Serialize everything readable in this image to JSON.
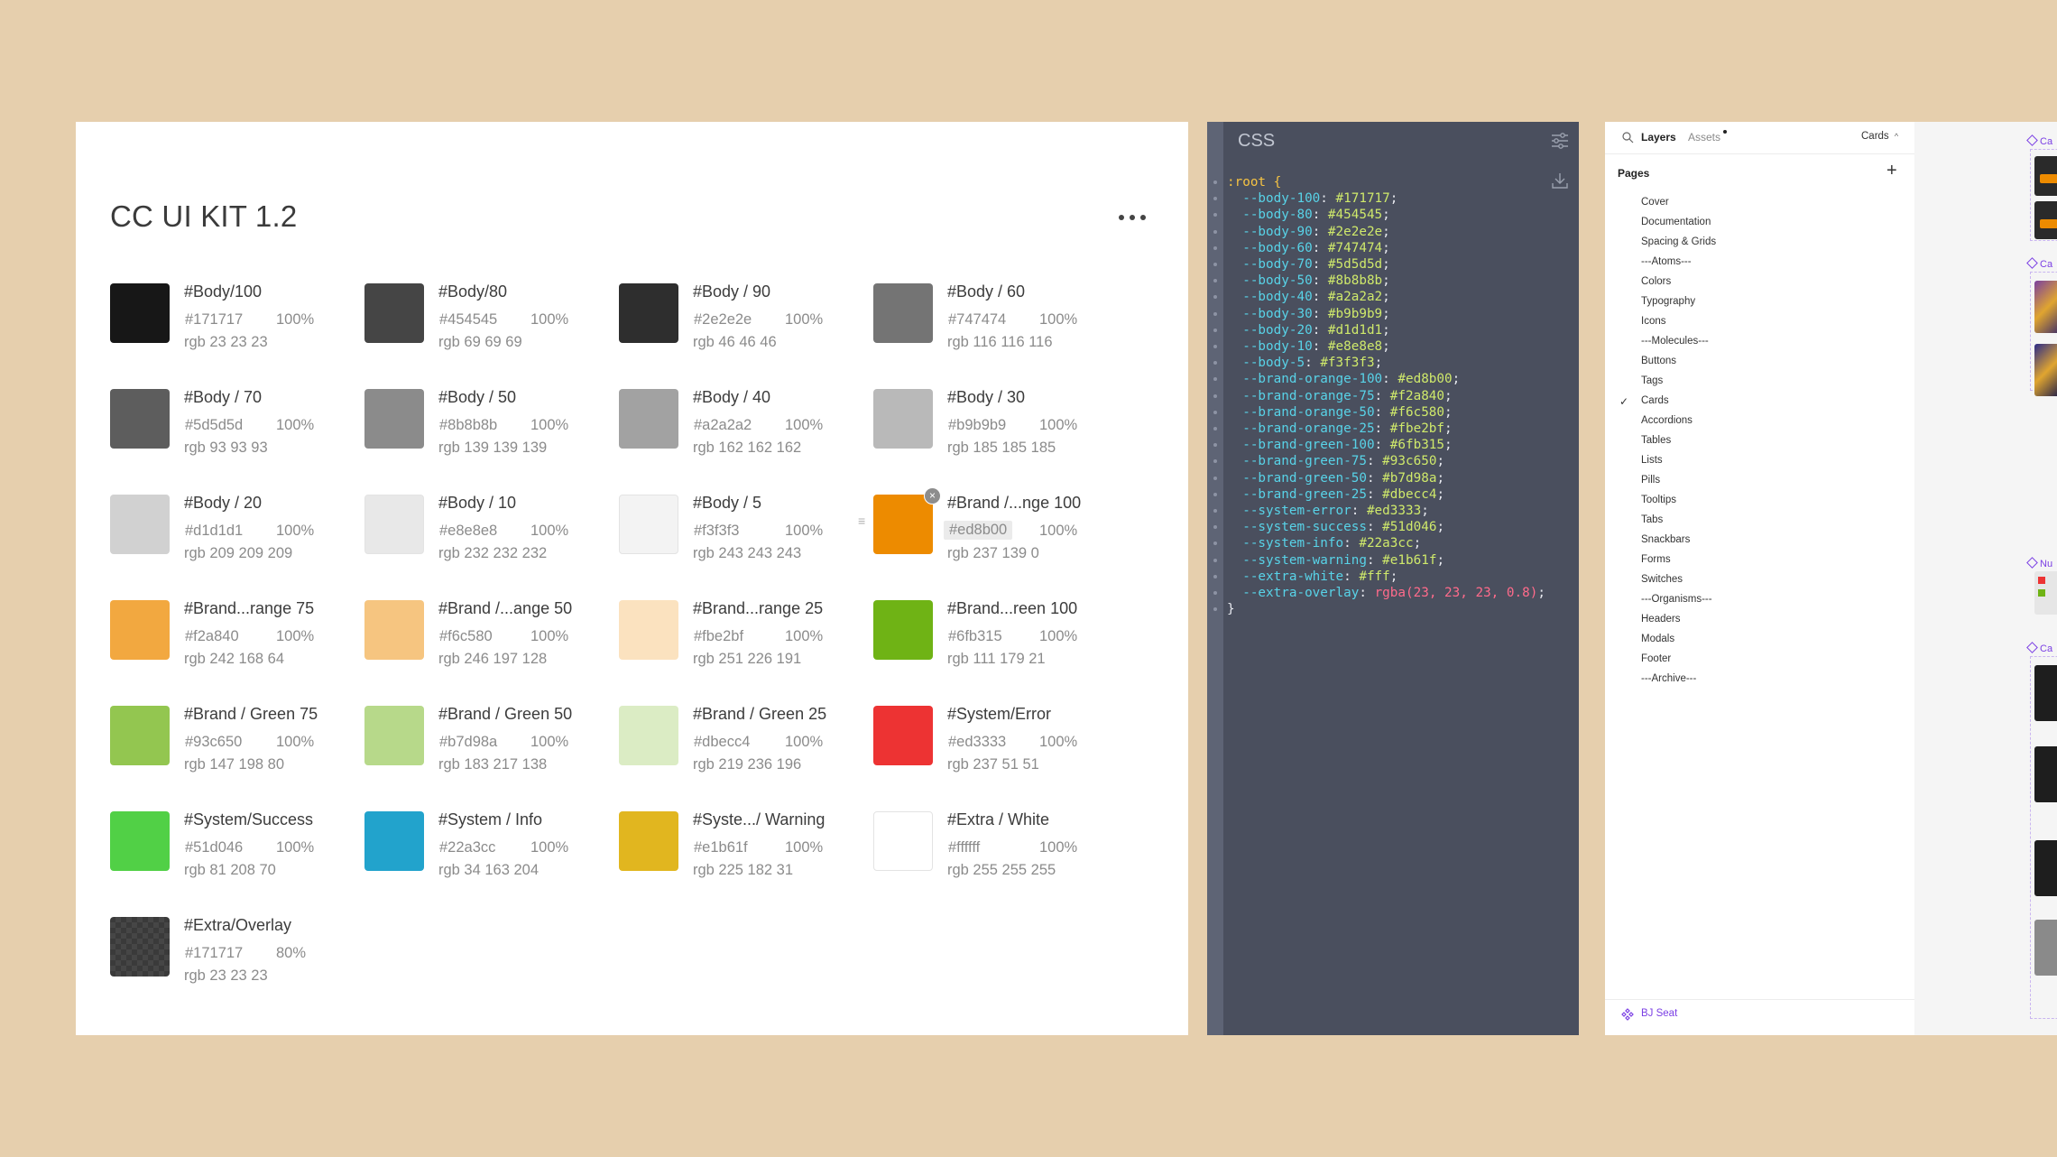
{
  "palette": {
    "title": "CC UI KIT 1.2",
    "swatches": [
      {
        "name": "#Body/100",
        "hex": "#171717",
        "opacity": "100%",
        "rgb": "rgb 23 23 23",
        "color": "#171717"
      },
      {
        "name": "#Body/80",
        "hex": "#454545",
        "opacity": "100%",
        "rgb": "rgb 69 69 69",
        "color": "#454545"
      },
      {
        "name": "#Body / 90",
        "hex": "#2e2e2e",
        "opacity": "100%",
        "rgb": "rgb 46 46 46",
        "color": "#2e2e2e"
      },
      {
        "name": "#Body / 60",
        "hex": "#747474",
        "opacity": "100%",
        "rgb": "rgb 116 116 116",
        "color": "#747474"
      },
      {
        "name": "#Body / 70",
        "hex": "#5d5d5d",
        "opacity": "100%",
        "rgb": "rgb 93 93 93",
        "color": "#5d5d5d"
      },
      {
        "name": "#Body / 50",
        "hex": "#8b8b8b",
        "opacity": "100%",
        "rgb": "rgb 139 139 139",
        "color": "#8b8b8b"
      },
      {
        "name": "#Body / 40",
        "hex": "#a2a2a2",
        "opacity": "100%",
        "rgb": "rgb 162 162 162",
        "color": "#a2a2a2"
      },
      {
        "name": "#Body / 30",
        "hex": "#b9b9b9",
        "opacity": "100%",
        "rgb": "rgb 185 185 185",
        "color": "#b9b9b9"
      },
      {
        "name": "#Body / 20",
        "hex": "#d1d1d1",
        "opacity": "100%",
        "rgb": "rgb 209 209 209",
        "color": "#d1d1d1"
      },
      {
        "name": "#Body / 10",
        "hex": "#e8e8e8",
        "opacity": "100%",
        "rgb": "rgb 232 232 232",
        "color": "#e8e8e8"
      },
      {
        "name": "#Body / 5",
        "hex": "#f3f3f3",
        "opacity": "100%",
        "rgb": "rgb 243 243 243",
        "color": "#f3f3f3"
      },
      {
        "name": "#Brand /...nge 100",
        "hex": "#ed8b00",
        "opacity": "100%",
        "rgb": "rgb 237 139 0",
        "color": "#ed8b00"
      },
      {
        "name": "#Brand...range 75",
        "hex": "#f2a840",
        "opacity": "100%",
        "rgb": "rgb 242 168 64",
        "color": "#f2a840"
      },
      {
        "name": "#Brand /...ange 50",
        "hex": "#f6c580",
        "opacity": "100%",
        "rgb": "rgb 246 197 128",
        "color": "#f6c580"
      },
      {
        "name": "#Brand...range 25",
        "hex": "#fbe2bf",
        "opacity": "100%",
        "rgb": "rgb 251 226 191",
        "color": "#fbe2bf"
      },
      {
        "name": "#Brand...reen 100",
        "hex": "#6fb315",
        "opacity": "100%",
        "rgb": "rgb 111 179 21",
        "color": "#6fb315"
      },
      {
        "name": "#Brand / Green 75",
        "hex": "#93c650",
        "opacity": "100%",
        "rgb": "rgb 147 198 80",
        "color": "#93c650"
      },
      {
        "name": "#Brand / Green 50",
        "hex": "#b7d98a",
        "opacity": "100%",
        "rgb": "rgb 183 217 138",
        "color": "#b7d98a"
      },
      {
        "name": "#Brand / Green 25",
        "hex": "#dbecc4",
        "opacity": "100%",
        "rgb": "rgb 219 236 196",
        "color": "#dbecc4"
      },
      {
        "name": "#System/Error",
        "hex": "#ed3333",
        "opacity": "100%",
        "rgb": "rgb 237 51 51",
        "color": "#ed3333"
      },
      {
        "name": "#System/Success",
        "hex": "#51d046",
        "opacity": "100%",
        "rgb": "rgb 81 208 70",
        "color": "#51d046"
      },
      {
        "name": "#System / Info",
        "hex": "#22a3cc",
        "opacity": "100%",
        "rgb": "rgb 34 163 204",
        "color": "#22a3cc"
      },
      {
        "name": "#Syste.../ Warning",
        "hex": "#e1b61f",
        "opacity": "100%",
        "rgb": "rgb 225 182 31",
        "color": "#e1b61f"
      },
      {
        "name": "#Extra / White",
        "hex": "#ffffff",
        "opacity": "100%",
        "rgb": "rgb 255 255 255",
        "color": "#ffffff"
      },
      {
        "name": "#Extra/Overlay",
        "hex": "#171717",
        "opacity": "80%",
        "rgb": "rgb 23 23 23",
        "color": "#171717"
      }
    ]
  },
  "css_panel": {
    "title": "CSS",
    "selector": ":root {",
    "closing": "}",
    "variables": [
      {
        "prop": "--body-100",
        "value": "#171717"
      },
      {
        "prop": "--body-80",
        "value": "#454545"
      },
      {
        "prop": "--body-90",
        "value": "#2e2e2e"
      },
      {
        "prop": "--body-60",
        "value": "#747474"
      },
      {
        "prop": "--body-70",
        "value": "#5d5d5d"
      },
      {
        "prop": "--body-50",
        "value": "#8b8b8b"
      },
      {
        "prop": "--body-40",
        "value": "#a2a2a2"
      },
      {
        "prop": "--body-30",
        "value": "#b9b9b9"
      },
      {
        "prop": "--body-20",
        "value": "#d1d1d1"
      },
      {
        "prop": "--body-10",
        "value": "#e8e8e8"
      },
      {
        "prop": "--body-5",
        "value": "#f3f3f3"
      },
      {
        "prop": "--brand-orange-100",
        "value": "#ed8b00"
      },
      {
        "prop": "--brand-orange-75",
        "value": "#f2a840"
      },
      {
        "prop": "--brand-orange-50",
        "value": "#f6c580"
      },
      {
        "prop": "--brand-orange-25",
        "value": "#fbe2bf"
      },
      {
        "prop": "--brand-green-100",
        "value": "#6fb315"
      },
      {
        "prop": "--brand-green-75",
        "value": "#93c650"
      },
      {
        "prop": "--brand-green-50",
        "value": "#b7d98a"
      },
      {
        "prop": "--brand-green-25",
        "value": "#dbecc4"
      },
      {
        "prop": "--system-error",
        "value": "#ed3333"
      },
      {
        "prop": "--system-success",
        "value": "#51d046"
      },
      {
        "prop": "--system-info",
        "value": "#22a3cc"
      },
      {
        "prop": "--system-warning",
        "value": "#e1b61f"
      },
      {
        "prop": "--extra-white",
        "value": "#fff"
      },
      {
        "prop": "--extra-overlay",
        "value": "rgba(23, 23, 23, 0.8)"
      }
    ]
  },
  "layers_panel": {
    "tab_layers": "Layers",
    "tab_assets": "Assets",
    "current_page": "Cards",
    "pages_label": "Pages",
    "pages": [
      "Cover",
      "Documentation",
      "Spacing & Grids",
      "---Atoms---",
      "Colors",
      "Typography",
      "Icons",
      "---Molecules---",
      "Buttons",
      "Tags",
      "Cards",
      "Accordions",
      "Tables",
      "Lists",
      "Pills",
      "Tooltips",
      "Tabs",
      "Snackbars",
      "Forms",
      "Switches",
      "---Organisms---",
      "Headers",
      "Modals",
      "Footer",
      "---Archive---"
    ],
    "selected_page": "Cards",
    "user": "BJ Seat"
  },
  "canvas": {
    "frame_labels": [
      "Ca",
      "Ca",
      "Nu",
      "Ca"
    ]
  },
  "colors": {
    "background": "#e6cfad",
    "css_panel_bg": "#4a4f5e",
    "accent_purple": "#7b3fe4"
  }
}
